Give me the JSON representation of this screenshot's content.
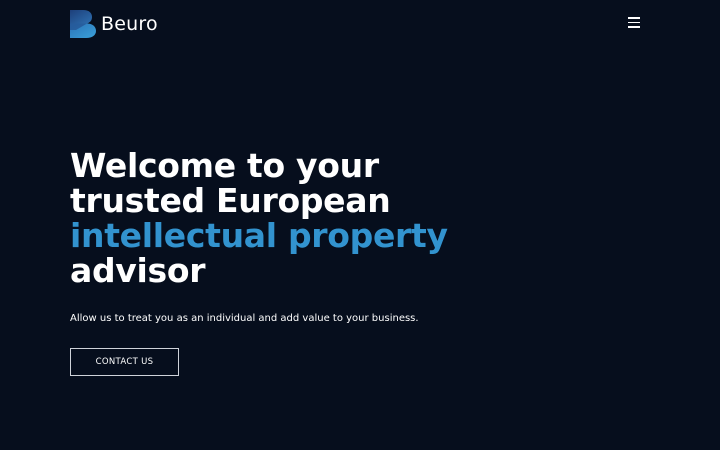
{
  "header": {
    "brand_name": "Beuro",
    "logo_icon": "beuro-logo-icon",
    "menu_icon": "hamburger-menu-icon"
  },
  "hero": {
    "title_lines": [
      "Welcome to your",
      "trusted European"
    ],
    "title_accent": "intellectual property",
    "title_last": "advisor",
    "subtitle": "Allow us to treat you as an individual and add value to your business.",
    "cta_label": "CONTACT US"
  },
  "colors": {
    "background": "#060e1d",
    "accent": "#3293cf",
    "text": "#ffffff"
  }
}
